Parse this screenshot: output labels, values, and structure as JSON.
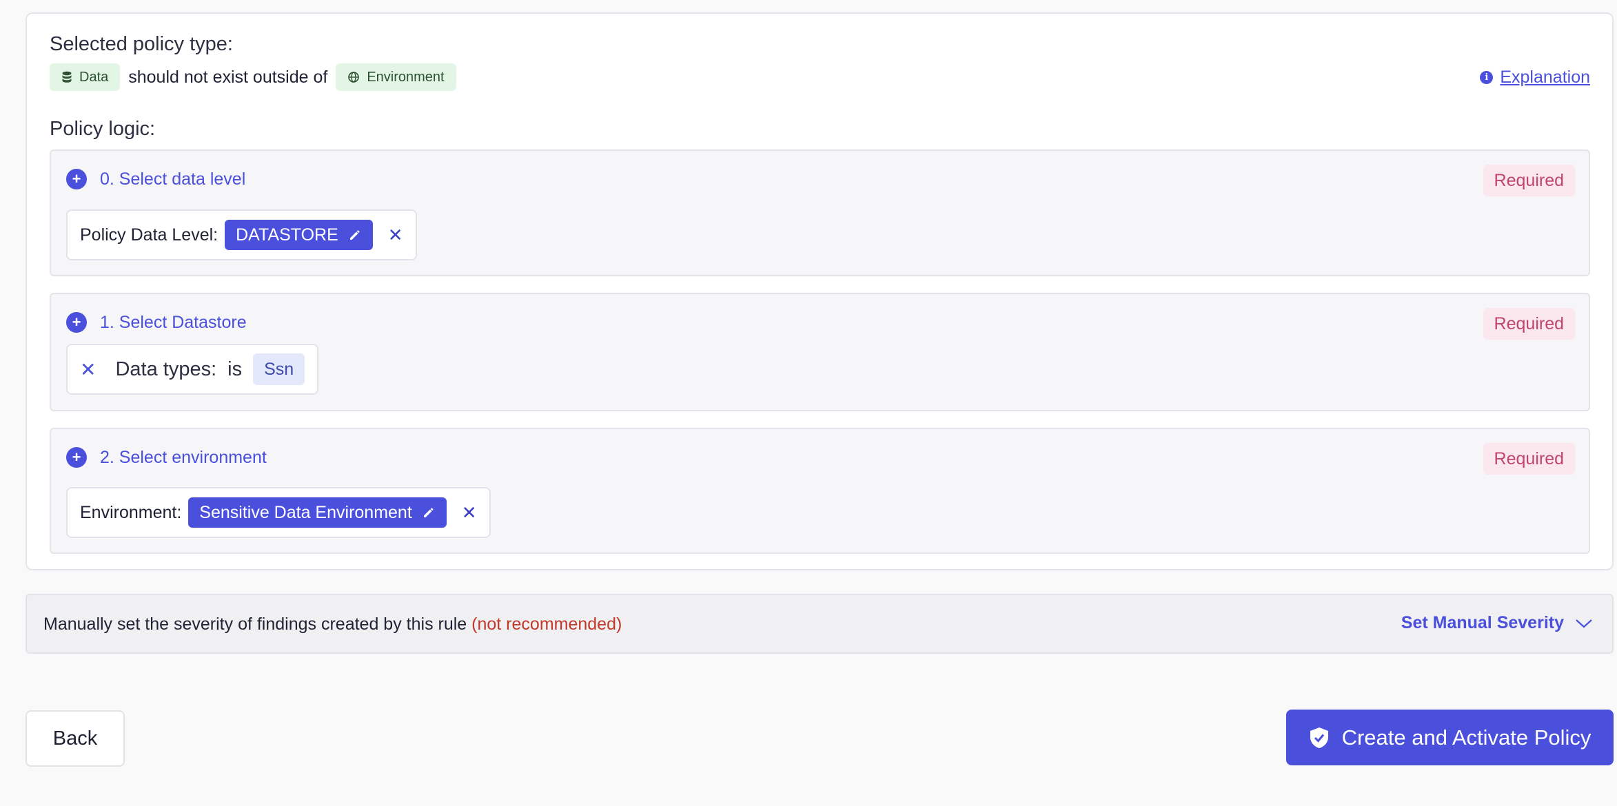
{
  "header": {
    "selected_label": "Selected policy type:",
    "subject_chip": "Data",
    "connector_text": "should not exist outside of",
    "object_chip": "Environment",
    "explanation_link": "Explanation",
    "policy_logic_label": "Policy logic:"
  },
  "steps": [
    {
      "title": "0. Select data level",
      "required": "Required",
      "condition_label": "Policy Data Level:",
      "value": "DATASTORE"
    },
    {
      "title": "1. Select Datastore",
      "required": "Required",
      "condition_label": "Data types:",
      "operator": "is",
      "value": "Ssn"
    },
    {
      "title": "2. Select environment",
      "required": "Required",
      "condition_label": "Environment:",
      "value": "Sensitive Data Environment"
    }
  ],
  "severity": {
    "text": "Manually set the severity of findings created by this rule",
    "warning": "(not recommended)",
    "link": "Set Manual Severity"
  },
  "footer": {
    "back_label": "Back",
    "create_label": "Create and Activate Policy"
  },
  "colors": {
    "accent": "#4a4fdc",
    "required_bg": "#fbe7ee",
    "required_text": "#c0456f",
    "chip_green_bg": "#e3f6e6",
    "warning": "#c0392b"
  },
  "icons": {
    "subject": "database-icon",
    "object": "globe-icon",
    "info": "info-icon",
    "add": "plus-circle-icon",
    "edit": "pencil-icon",
    "remove": "close-icon",
    "severity": "chevron-down-icon",
    "create": "shield-check-icon"
  }
}
